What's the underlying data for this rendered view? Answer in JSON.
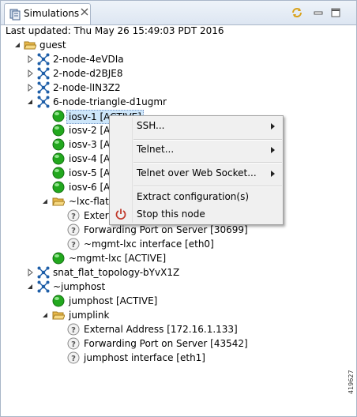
{
  "view": {
    "tab_title": "Simulations",
    "last_updated": "Last updated: Thu May 26 15:49:03 PDT 2016"
  },
  "tree": {
    "guest": "guest",
    "sim1": "2-node-4eVDIa",
    "sim2": "2-node-d2BJE8",
    "sim3": "2-node-lIN3Z2",
    "sim4": "6-node-triangle-d1ugmr",
    "iosv1": "iosv-1 [ACTIVE]",
    "iosv2": "iosv-2 [A",
    "iosv3": "iosv-3 [A",
    "iosv4": "iosv-4 [A",
    "iosv5": "iosv-5 [A",
    "iosv6": "iosv-6 [A",
    "lxc_flat": "~lxc-flat",
    "lxc_ext": "Extern",
    "lxc_fwd": "Forwarding Port on Server [30699]",
    "lxc_if": "~mgmt-lxc interface [eth0]",
    "mgmt_lxc": "~mgmt-lxc [ACTIVE]",
    "snat": "snat_flat_topology-bYvX1Z",
    "jumphost_sim": "~jumphost",
    "jumphost": "jumphost [ACTIVE]",
    "jumplink": "jumplink",
    "jl_ext": "External Address [172.16.1.133]",
    "jl_fwd": "Forwarding Port on Server [43542]",
    "jl_if": "jumphost interface [eth1]"
  },
  "context_menu": {
    "ssh": "SSH...",
    "telnet": "Telnet...",
    "telnet_ws": "Telnet over Web Socket...",
    "extract": "Extract configuration(s)",
    "stop": "Stop this node"
  },
  "watermark": "419627",
  "colors": {
    "active_node": "#22a81e",
    "topology_icon": "#1f5fa8",
    "folder": "#e8b84a",
    "stop_icon": "#c0392b"
  }
}
